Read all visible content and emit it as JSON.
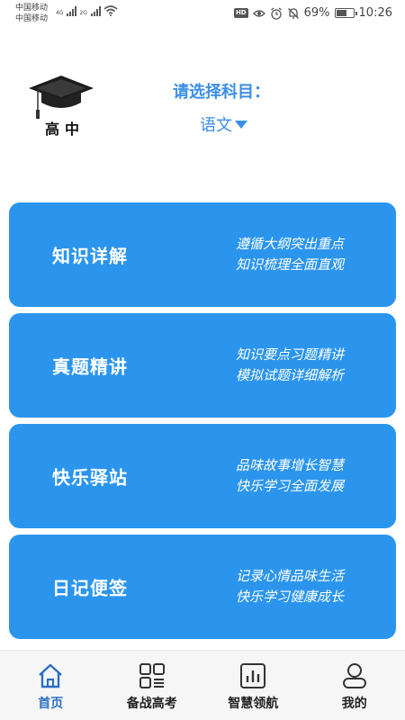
{
  "status_bar": {
    "carrier_line1": "中国移动",
    "carrier_line2": "中国移动",
    "net1": "4G",
    "net2": "2G",
    "hd": "HD",
    "battery": "69%",
    "battery_level": 0.69,
    "time": "10:26"
  },
  "header": {
    "logo_text": "高中",
    "subject_prompt": "请选择科目：",
    "subject_value": "语文"
  },
  "cards": [
    {
      "title": "知识详解",
      "desc_line1": "遵循大纲突出重点",
      "desc_line2": "知识梳理全面直观"
    },
    {
      "title": "真题精讲",
      "desc_line1": "知识要点习题精讲",
      "desc_line2": "模拟试题详细解析"
    },
    {
      "title": "快乐驿站",
      "desc_line1": "品味故事增长智慧",
      "desc_line2": "快乐学习全面发展"
    },
    {
      "title": "日记便签",
      "desc_line1": "记录心情品味生活",
      "desc_line2": "快乐学习健康成长"
    }
  ],
  "bottom_nav": {
    "items": [
      {
        "label": "首页",
        "icon": "home-icon",
        "active": true
      },
      {
        "label": "备战高考",
        "icon": "grid-icon",
        "active": false
      },
      {
        "label": "智慧领航",
        "icon": "chart-icon",
        "active": false
      },
      {
        "label": "我的",
        "icon": "profile-icon",
        "active": false
      }
    ]
  },
  "colors": {
    "accent": "#2b95ee",
    "subject_text": "#3a8ee6",
    "active_nav": "#2b6fc4"
  }
}
